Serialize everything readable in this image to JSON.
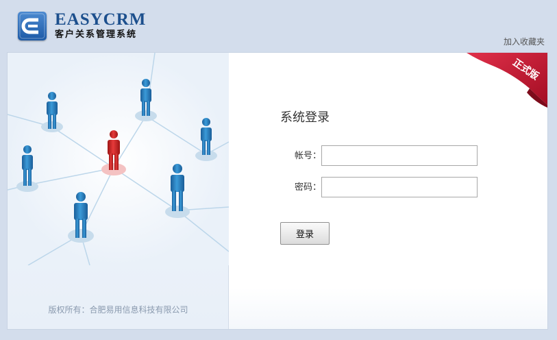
{
  "header": {
    "brand": "EASYCRM",
    "subtitle": "客户关系管理系统",
    "bookmark_link": "加入收藏夹"
  },
  "left_panel": {
    "copyright": "版权所有：合肥易用信息科技有限公司"
  },
  "login": {
    "edition_ribbon": "正式版",
    "title": "系统登录",
    "account_label": "帐号：",
    "account_value": "",
    "password_label": "密码：",
    "password_value": "",
    "submit_label": "登录"
  },
  "colors": {
    "background": "#d3ddec",
    "brand": "#1c4f8d",
    "ribbon": "#c8102e",
    "person_blue": "#2f86c6",
    "person_red": "#d62b2b"
  },
  "icons": [
    "logo-e-icon",
    "person-icon",
    "person-highlight-icon",
    "ribbon-icon"
  ]
}
